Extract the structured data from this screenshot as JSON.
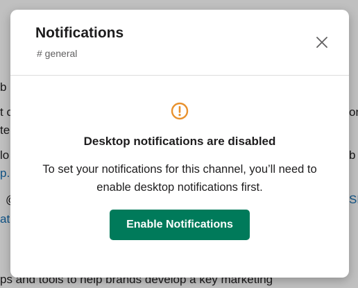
{
  "modal": {
    "title": "Notifications",
    "channel": "# general",
    "heading": "Desktop notifications are disabled",
    "body": "To set your notifications for this channel, you’ll need to enable desktop notifications first.",
    "button_label": "Enable Notifications",
    "close_icon": "close-icon",
    "warning_icon": "warning-circle-icon"
  },
  "background": {
    "lines": [
      {
        "text": "b",
        "link": false
      },
      {
        "text": "t c",
        "link": false
      },
      {
        "text": "te",
        "link": false
      },
      {
        "text": "lo",
        "link": false
      },
      {
        "text": "p.",
        "link": true
      },
      {
        "text": "@",
        "link": false
      },
      {
        "text": "atu",
        "link": true
      },
      {
        "text": "on",
        "link": false
      },
      {
        "text": "b",
        "link": false
      },
      {
        "text": "SF",
        "link": true
      },
      {
        "text": "ps and tools to help brands develop a key marketing",
        "link": false
      }
    ]
  },
  "colors": {
    "accent": "#007a5a",
    "warning": "#e8912d"
  }
}
